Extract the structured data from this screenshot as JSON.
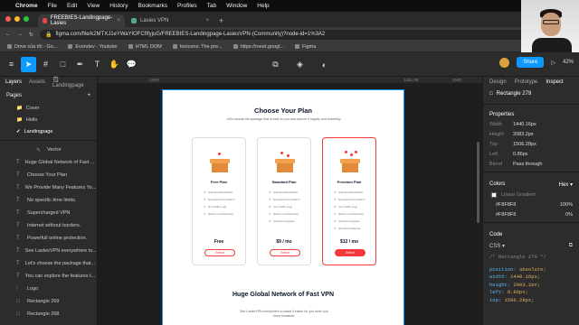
{
  "menubar": {
    "app": "Chrome",
    "items": [
      "File",
      "Edit",
      "View",
      "History",
      "Bookmarks",
      "Profiles",
      "Tab",
      "Window",
      "Help"
    ]
  },
  "tabs": [
    {
      "title": "FREEBIES-Landingpage-Lasies",
      "active": true
    },
    {
      "title": "Lasies VPN",
      "active": false
    }
  ],
  "address": {
    "url": "figma.com/file/k2MTXJ1eYWaYlOFCfIfyjuG/FREEBIES-Landingpage-LasiesVPN-(Community)?node-id=1%3A2"
  },
  "bookmarks": [
    "Drive của tôi - Go...",
    "Evondev - Youtube",
    "HTML DOM",
    "Ionicons: The pre...",
    "https://meet.googl...",
    "Figma"
  ],
  "left_panel": {
    "tabs": [
      "Layers",
      "Assets",
      "Landingpage"
    ],
    "pages_header": "Pages",
    "pages": [
      "Cover",
      "Hello",
      "Landingpage"
    ],
    "active_page": "Landingpage",
    "layers": [
      "Vector",
      "Huge Global Network of Fast ...",
      "Choose Your Plan",
      "We Provide Many Features Yo...",
      "No specific time limits.",
      "Supercharged VPN",
      "Internet without borders.",
      "Powerfull online protection.",
      "See LaslesVPN everywhere to...",
      "Let's choose the package that...",
      "You can explore the features t...",
      "Logo",
      "Rectangle 269",
      "Rectangle 268"
    ]
  },
  "canvas": {
    "ruler_marks": [
      "-1000",
      "1441.08",
      "1540"
    ],
    "frame": {
      "title": "Choose Your Plan",
      "subtitle": "Let's choose the package that is best for you and explore it happily and cheerfully.",
      "plans": [
        {
          "name": "Free Plan",
          "price": "Free",
          "button": "Select",
          "features": [
            "Unlimited Bandwitch",
            "Encrypted Connection",
            "No Traffic Logs",
            "Works on All Devices"
          ]
        },
        {
          "name": "Standard Plan",
          "price": "$9 / mo",
          "button": "Select",
          "features": [
            "Unlimited Bandwitch",
            "Encrypted Connection",
            "Yes Traffic Logs",
            "Works on All Devices",
            "Connect Anyware"
          ]
        },
        {
          "name": "Premium Plan",
          "price": "$12 / mo",
          "button": "Select",
          "features": [
            "Unlimited Bandwitch",
            "Encrypted Connection",
            "Yes Traffic Logs",
            "Works on All Devices",
            "Connect Anyware",
            "Get New Features"
          ]
        }
      ],
      "section2_title": "Huge Global Network of Fast VPN",
      "section2_sub": "See LaslesVPN everywhere to make it easier for you when you move locations."
    }
  },
  "right_panel": {
    "tabs": [
      "Design",
      "Prototype",
      "Inspect"
    ],
    "active_tab": "Inspect",
    "selection": "Rectangle 279",
    "properties_header": "Properties",
    "props": [
      {
        "k": "Width",
        "v": "1440.16px"
      },
      {
        "k": "Height",
        "v": "2083.2px"
      },
      {
        "k": "Top",
        "v": "1506.28px"
      },
      {
        "k": "Left",
        "v": "0.86px"
      },
      {
        "k": "Blend",
        "v": "Pass through"
      }
    ],
    "colors_header": "Colors",
    "color_format": "Hex",
    "gradient_label": "Linear Gradient",
    "stops": [
      {
        "hex": "#F8F8F8",
        "pct": "100%"
      },
      {
        "hex": "#F8F8F8",
        "pct": "0%"
      }
    ],
    "code_header": "Code",
    "code_lang": "CSS",
    "code_comment": "/* Rectangle 279 */",
    "code_lines": [
      {
        "p": "position:",
        "v": "absolute;"
      },
      {
        "p": "width:",
        "v": "1440.16px;"
      },
      {
        "p": "height:",
        "v": "2083.2px;"
      },
      {
        "p": "left:",
        "v": "0.86px;"
      },
      {
        "p": "top:",
        "v": "1506.28px;"
      }
    ]
  },
  "toolbar": {
    "share_label": "Share",
    "zoom": "42%"
  },
  "colors": {
    "accent": "#0d99ff",
    "brand_red": "#f53838"
  }
}
